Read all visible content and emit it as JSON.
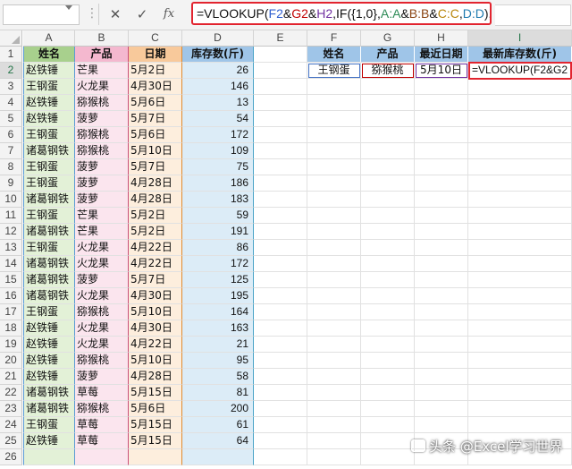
{
  "formula_bar": {
    "parts": [
      {
        "t": "=VLOOKUP(",
        "c": "#111111"
      },
      {
        "t": "F2",
        "c": "#2f5fd0"
      },
      {
        "t": "&",
        "c": "#111111"
      },
      {
        "t": "G2",
        "c": "#c00000"
      },
      {
        "t": "&",
        "c": "#111111"
      },
      {
        "t": "H2",
        "c": "#7030a0"
      },
      {
        "t": ",IF({1,0},",
        "c": "#111111"
      },
      {
        "t": "A:A",
        "c": "#2e8b57"
      },
      {
        "t": "&",
        "c": "#111111"
      },
      {
        "t": "B:B",
        "c": "#8b4513"
      },
      {
        "t": "&",
        "c": "#111111"
      },
      {
        "t": "C:C",
        "c": "#b8860b"
      },
      {
        "t": ",",
        "c": "#111111"
      },
      {
        "t": "D:D",
        "c": "#1f7bb0"
      },
      {
        "t": "),2,0)",
        "c": "#111111"
      }
    ],
    "cancel_symbol": "✕",
    "enter_symbol": "✓",
    "fx_symbol": "fx",
    "dots": "⋮"
  },
  "columns": [
    "A",
    "B",
    "C",
    "D",
    "E",
    "F",
    "G",
    "H",
    "I"
  ],
  "headers": {
    "A": "姓名",
    "B": "产品",
    "C": "日期",
    "D": "库存数(斤)"
  },
  "rows": [
    {
      "n": "2",
      "a": "赵铁锤",
      "b": "芒果",
      "c": "5月2日",
      "d": "26"
    },
    {
      "n": "3",
      "a": "王钢蛋",
      "b": "火龙果",
      "c": "4月30日",
      "d": "146"
    },
    {
      "n": "4",
      "a": "赵铁锤",
      "b": "猕猴桃",
      "c": "5月6日",
      "d": "13"
    },
    {
      "n": "5",
      "a": "赵铁锤",
      "b": "菠萝",
      "c": "5月7日",
      "d": "54"
    },
    {
      "n": "6",
      "a": "王钢蛋",
      "b": "猕猴桃",
      "c": "5月6日",
      "d": "172"
    },
    {
      "n": "7",
      "a": "诸葛钢铁",
      "b": "猕猴桃",
      "c": "5月10日",
      "d": "109"
    },
    {
      "n": "8",
      "a": "王钢蛋",
      "b": "菠萝",
      "c": "5月7日",
      "d": "75"
    },
    {
      "n": "9",
      "a": "王钢蛋",
      "b": "菠萝",
      "c": "4月28日",
      "d": "186"
    },
    {
      "n": "10",
      "a": "诸葛钢铁",
      "b": "菠萝",
      "c": "4月28日",
      "d": "183"
    },
    {
      "n": "11",
      "a": "王钢蛋",
      "b": "芒果",
      "c": "5月2日",
      "d": "59"
    },
    {
      "n": "12",
      "a": "诸葛钢铁",
      "b": "芒果",
      "c": "5月2日",
      "d": "191"
    },
    {
      "n": "13",
      "a": "王钢蛋",
      "b": "火龙果",
      "c": "4月22日",
      "d": "86"
    },
    {
      "n": "14",
      "a": "诸葛钢铁",
      "b": "火龙果",
      "c": "4月22日",
      "d": "172"
    },
    {
      "n": "15",
      "a": "诸葛钢铁",
      "b": "菠萝",
      "c": "5月7日",
      "d": "125"
    },
    {
      "n": "16",
      "a": "诸葛钢铁",
      "b": "火龙果",
      "c": "4月30日",
      "d": "195"
    },
    {
      "n": "17",
      "a": "王钢蛋",
      "b": "猕猴桃",
      "c": "5月10日",
      "d": "164"
    },
    {
      "n": "18",
      "a": "赵铁锤",
      "b": "火龙果",
      "c": "4月30日",
      "d": "163"
    },
    {
      "n": "19",
      "a": "赵铁锤",
      "b": "火龙果",
      "c": "4月22日",
      "d": "21"
    },
    {
      "n": "20",
      "a": "赵铁锤",
      "b": "猕猴桃",
      "c": "5月10日",
      "d": "95"
    },
    {
      "n": "21",
      "a": "赵铁锤",
      "b": "菠萝",
      "c": "4月28日",
      "d": "58"
    },
    {
      "n": "22",
      "a": "诸葛钢铁",
      "b": "草莓",
      "c": "5月15日",
      "d": "81"
    },
    {
      "n": "23",
      "a": "诸葛钢铁",
      "b": "猕猴桃",
      "c": "5月6日",
      "d": "200"
    },
    {
      "n": "24",
      "a": "王钢蛋",
      "b": "草莓",
      "c": "5月15日",
      "d": "61"
    },
    {
      "n": "25",
      "a": "赵铁锤",
      "b": "草莓",
      "c": "5月15日",
      "d": "64"
    },
    {
      "n": "26",
      "a": "",
      "b": "",
      "c": "",
      "d": ""
    }
  ],
  "lookup": {
    "headers": {
      "F": "姓名",
      "G": "产品",
      "H": "最近日期",
      "I": "最新库存数(斤)"
    },
    "values": {
      "F": "王钢蛋",
      "G": "猕猴桃",
      "H": "5月10日",
      "I": "=VLOOKUP(F2&G2"
    }
  },
  "watermark": "头条 @Excel学习世界",
  "colors": {
    "accent_red": "#e2242f",
    "hdr_green": "#a8d08d",
    "hdr_pink": "#f4b8cf",
    "hdr_orange": "#f8c99b",
    "hdr_blue": "#9fc5e8"
  }
}
